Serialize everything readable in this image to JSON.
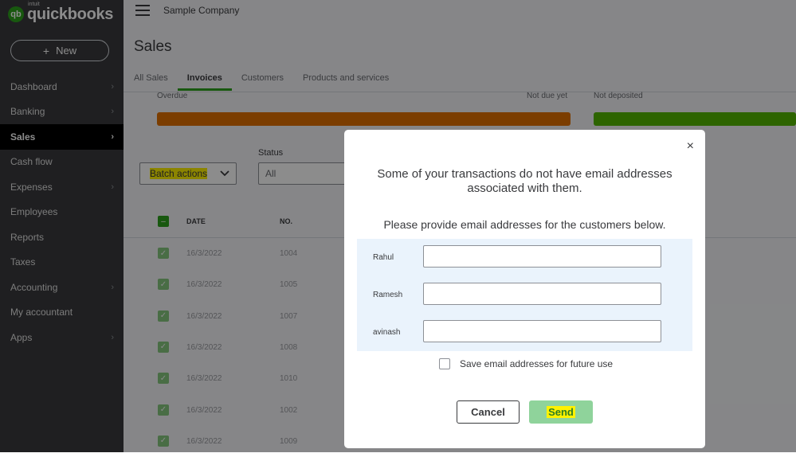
{
  "brand": {
    "mark": "qb",
    "intuit": "intuit",
    "name": "quickbooks"
  },
  "new_button": {
    "icon": "+",
    "label": "New"
  },
  "sidebar": {
    "items": [
      {
        "label": "Dashboard",
        "chevron": true
      },
      {
        "label": "Banking",
        "chevron": true
      },
      {
        "label": "Sales",
        "chevron": true,
        "active": true
      },
      {
        "label": "Cash flow",
        "chevron": false
      },
      {
        "label": "Expenses",
        "chevron": true
      },
      {
        "label": "Employees",
        "chevron": false
      },
      {
        "label": "Reports",
        "chevron": false
      },
      {
        "label": "Taxes",
        "chevron": false
      },
      {
        "label": "Accounting",
        "chevron": true
      },
      {
        "label": "My accountant",
        "chevron": false
      },
      {
        "label": "Apps",
        "chevron": true
      }
    ]
  },
  "header": {
    "company": "Sample Company",
    "title": "Sales"
  },
  "tabs": [
    "All Sales",
    "Invoices",
    "Customers",
    "Products and services"
  ],
  "summary": {
    "overdue": "Overdue",
    "not_due": "Not due yet",
    "not_deposited": "Not deposited",
    "colors": {
      "overdue": "#e07000",
      "deposited": "#53b700"
    }
  },
  "filters": {
    "batch_actions": "Batch actions",
    "status_label": "Status",
    "status_value": "All"
  },
  "table": {
    "headers": {
      "date": "DATE",
      "no": "NO."
    },
    "rows": [
      {
        "date": "16/3/2022",
        "no": "1004"
      },
      {
        "date": "16/3/2022",
        "no": "1005"
      },
      {
        "date": "16/3/2022",
        "no": "1007"
      },
      {
        "date": "16/3/2022",
        "no": "1008"
      },
      {
        "date": "16/3/2022",
        "no": "1010"
      },
      {
        "date": "16/3/2022",
        "no": "1002"
      },
      {
        "date": "16/3/2022",
        "no": "1009"
      }
    ]
  },
  "modal": {
    "close": "×",
    "heading": "Some of your transactions do not have email addresses associated with them.",
    "subheading": "Please provide email addresses for the customers below.",
    "customers": [
      {
        "name": "Rahul",
        "email": ""
      },
      {
        "name": "Ramesh",
        "email": ""
      },
      {
        "name": "avinash",
        "email": ""
      }
    ],
    "save_label": "Save email addresses for future use",
    "cancel": "Cancel",
    "send": "Send"
  }
}
